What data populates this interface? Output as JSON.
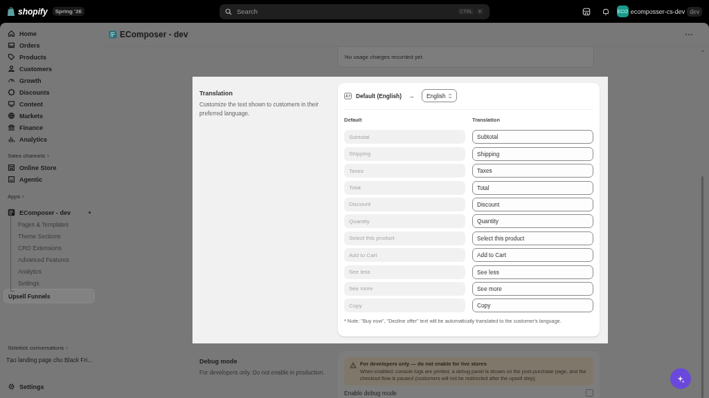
{
  "top_bar": {
    "brand": "shopify",
    "edition": "Spring '26",
    "search": {
      "placeholder": "Search",
      "shortcut": [
        "CTRL",
        "K"
      ]
    },
    "account": {
      "initials": "ECO",
      "name": "ecomposser-cs-dev",
      "badge": "dev"
    }
  },
  "sidebar": {
    "items": [
      {
        "label": "Home"
      },
      {
        "label": "Orders"
      },
      {
        "label": "Products"
      },
      {
        "label": "Customers"
      },
      {
        "label": "Growth"
      },
      {
        "label": "Discounts"
      },
      {
        "label": "Content"
      },
      {
        "label": "Markets"
      },
      {
        "label": "Finance"
      },
      {
        "label": "Analytics"
      }
    ],
    "sales_channels": {
      "heading": "Sales channels",
      "items": [
        {
          "label": "Online Store"
        },
        {
          "label": "Agentic"
        }
      ]
    },
    "apps": {
      "heading": "Apps",
      "app": {
        "label": "EComposer - dev",
        "pinned": true
      },
      "children": [
        {
          "label": "Pages & Templates",
          "selected": false
        },
        {
          "label": "Theme Sections",
          "selected": false
        },
        {
          "label": "CRO Extensions",
          "selected": false
        },
        {
          "label": "Advanced Features",
          "selected": false
        },
        {
          "label": "Analytics",
          "selected": false
        },
        {
          "label": "Settings",
          "selected": false
        },
        {
          "label": "Upsell Funnels",
          "selected": true
        }
      ]
    },
    "sidekick": {
      "heading": "Sidekick conversations",
      "conversations": [
        "Tạo landing page cho Black Fri..."
      ]
    },
    "settings": "Settings"
  },
  "page": {
    "title": "EComposer - dev",
    "usage_card": {
      "message": "No usage charges recorded yet."
    },
    "translation": {
      "title": "Translation",
      "description": "Customize the text shown to customers in their preferred language.",
      "source_label": "Default (English)",
      "arrow": "→",
      "language": "English",
      "columns": [
        "Default",
        "Translation"
      ],
      "rows": [
        {
          "default": "Subtotal",
          "translation": "Subtotal"
        },
        {
          "default": "Shipping",
          "translation": "Shipping"
        },
        {
          "default": "Taxes",
          "translation": "Taxes"
        },
        {
          "default": "Total",
          "translation": "Total"
        },
        {
          "default": "Discount",
          "translation": "Discount"
        },
        {
          "default": "Quantity",
          "translation": "Quantity"
        },
        {
          "default": "Select this product",
          "translation": "Select this product"
        },
        {
          "default": "Add to Cart",
          "translation": "Add to Cart"
        },
        {
          "default": "See less",
          "translation": "See less"
        },
        {
          "default": "See more",
          "translation": "See more"
        },
        {
          "default": "Copy",
          "translation": "Copy"
        }
      ],
      "note": "* Note: \"Buy now\", \"Decline offer\" text will be automatically translated to the customer's language."
    },
    "debug": {
      "title": "Debug mode",
      "description": "For developers only. Do not enable in production.",
      "warning": {
        "title": "For developers only — do not enable for live stores",
        "body": "When enabled: console logs are printed, a debug panel is shown on the post-purchase page, and the checkout flow is paused (customers will not be redirected after the upsell step)."
      },
      "toggle": {
        "label": "Enable debug mode",
        "checked": false
      }
    }
  }
}
